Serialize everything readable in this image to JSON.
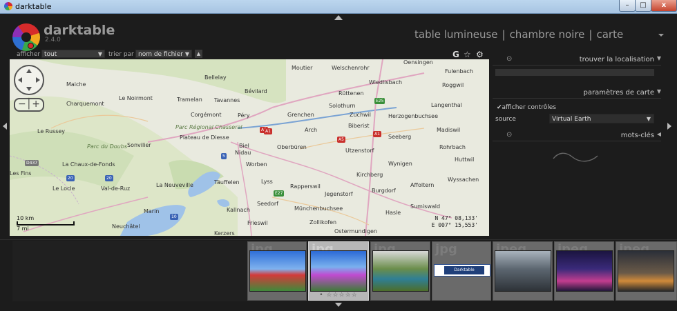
{
  "window": {
    "title": "darktable",
    "min_glyph": "–",
    "max_glyph": "□",
    "close_glyph": "x"
  },
  "app": {
    "name": "darktable",
    "version": "2.4.0"
  },
  "views": {
    "lighttable": "table lumineuse",
    "darkroom": "chambre noire",
    "map": "carte",
    "sep": "|"
  },
  "filter": {
    "show_label": "afficher",
    "show_value": "tout",
    "sort_label": "trier par",
    "sort_value": "nom de fichier"
  },
  "top_icons": {
    "grouping": "G",
    "star": "☆",
    "prefs": "⚙"
  },
  "map": {
    "scale": [
      "10 km",
      "7 mi"
    ],
    "coords": {
      "lat": "N 47° 08,133'",
      "lon": "E 007° 15,553'"
    },
    "places": [
      "Moutier",
      "Welschenrohr",
      "Oensingen",
      "Bellelay",
      "Fulenbach",
      "Maiche",
      "Bévilard",
      "Wiedlisbach",
      "Roggwil",
      "Le Noirmont",
      "Tramelan",
      "Tavannes",
      "Rüttenen",
      "Charquemont",
      "Corgémont",
      "Péry",
      "Grenchen",
      "Solothurn",
      "Zuchwil",
      "Langenthal",
      "Parc Régional Chasseral",
      "Herzogenbuchsee",
      "Le Russey",
      "Arch",
      "Biberist",
      "Madiswil",
      "Parc du Doubs",
      "Sonvilier",
      "Biel",
      "Nidau",
      "Oberbüren",
      "Utzenstorf",
      "Seeberg",
      "Rohrbach",
      "Plateau de Diesse",
      "Worben",
      "Huttwil",
      "La Chaux-de-Fonds",
      "Wynigen",
      "Les Fins",
      "Lyss",
      "Kirchberg",
      "Le Locle",
      "Val-de-Ruz",
      "La Neuveville",
      "Täuffelen",
      "Rapperswil",
      "Jegenstorf",
      "Affoltern",
      "Wyssachen",
      "Burgdorf",
      "Seedorf",
      "Münchenbuchsee",
      "Sumiswald",
      "Marin",
      "Kallnach",
      "Hasle",
      "Neuchâtel",
      "Frieswil",
      "Zollikofen",
      "Kerzers",
      "Ostermundigen"
    ],
    "road_shields": [
      "A5",
      "A5",
      "A1",
      "A1",
      "E25",
      "E27",
      "5",
      "20",
      "20",
      "10",
      "D437"
    ]
  },
  "right_panel": {
    "find_location": "trouver la localisation",
    "map_settings": "paramètres de carte",
    "show_controls": "afficher contrôles",
    "source_label": "source",
    "source_value": "Virtual Earth",
    "tags": "mots-clés"
  },
  "filmstrip": {
    "thumbs": [
      {
        "ext": "jpg",
        "stars": "",
        "selected": false,
        "theme": "poppies"
      },
      {
        "ext": "jpg",
        "stars": "• ☆☆☆☆☆ ",
        "selected": true,
        "theme": "cosmos"
      },
      {
        "ext": "jpg",
        "stars": "",
        "selected": false,
        "theme": "garden"
      },
      {
        "ext": "jpg",
        "stars": "",
        "selected": false,
        "theme": "darktable-ui",
        "caption": "Darktable"
      },
      {
        "ext": "jpeg",
        "stars": "",
        "selected": false,
        "theme": "street"
      },
      {
        "ext": "jpeg",
        "stars": "",
        "selected": false,
        "theme": "city-night"
      },
      {
        "ext": "jpeg",
        "stars": "",
        "selected": false,
        "theme": "skyline"
      }
    ]
  },
  "colors": {
    "bg": "#1c1c1c",
    "map_land": "#e9eadf",
    "lake": "#9fc2e8",
    "forest": "#c9dcb0"
  }
}
